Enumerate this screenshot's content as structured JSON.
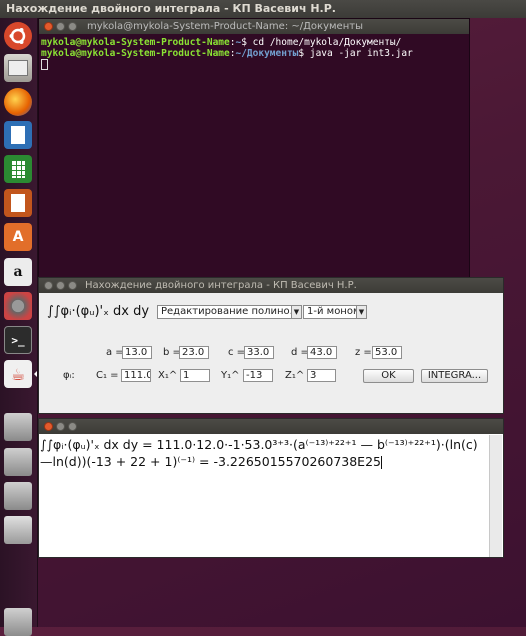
{
  "top_panel": {
    "title": "Нахождение двойного интеграла  -  КП Васевич Н.Р."
  },
  "launcher": {
    "items": [
      "ubuntu-icon",
      "files-icon",
      "firefox-icon",
      "writer-icon",
      "calc-icon",
      "impress-icon",
      "software-center-icon",
      "amazon-icon",
      "settings-icon",
      "terminal-icon",
      "java-icon",
      "drive-icon",
      "drive-icon",
      "drive-icon",
      "usb-icon",
      "trash-icon"
    ]
  },
  "terminal": {
    "title": "mykola@mykola-System-Product-Name: ~/Документы",
    "line1_user": "mykola@mykola-System-Product-Name",
    "line1_path": "~",
    "line1_cmd": "$ cd /home/mykola/Документы/",
    "line2_user": "mykola@mykola-System-Product-Name",
    "line2_path": "~/Документы",
    "line2_cmd": "$ java -jar int3.jar"
  },
  "form": {
    "title": "Нахождение двойного интеграла  -  КП Васевич Н.Р.",
    "formula": "∫∫φᵢ·(φᵤ)'ₓ dx dy",
    "combo1": "Редактирование полино...",
    "combo2": "1-й моном",
    "a_label": "a =",
    "a_value": "13.0",
    "b_label": "b =",
    "b_value": "23.0",
    "c_label": "c =",
    "c_value": "33.0",
    "d_label": "d =",
    "d_value": "43.0",
    "z_label": "z =",
    "z_value": "53.0",
    "phi_label": "φᵢ:",
    "c1_label": "C₁ =",
    "c1_value": "111.0",
    "x1_label": "X₁^",
    "x1_value": "1",
    "y1_label": "Y₁^",
    "y1_value": "-13",
    "z1_label": "Z₁^",
    "z1_value": "3",
    "ok_label": "OK",
    "integrate_label": "INTEGRA..."
  },
  "result": {
    "text": "∫∫φᵢ·(φᵤ)'ₓ dx dy = 111.0·12.0·-1·53.0³⁺³·(a⁽⁻¹³⁾⁺²²⁺¹ — b⁽⁻¹³⁾⁺²²⁺¹)·(ln(c) —ln(d))(-13 + 22 + 1)⁽⁻¹⁾ = -3.2265015570260738E25"
  },
  "colors": {
    "desktop": "#4b1835",
    "terminal_bg": "#300a24",
    "prompt_user": "#8ae234",
    "prompt_path": "#729fcf",
    "close_button": "#e35a2c"
  }
}
